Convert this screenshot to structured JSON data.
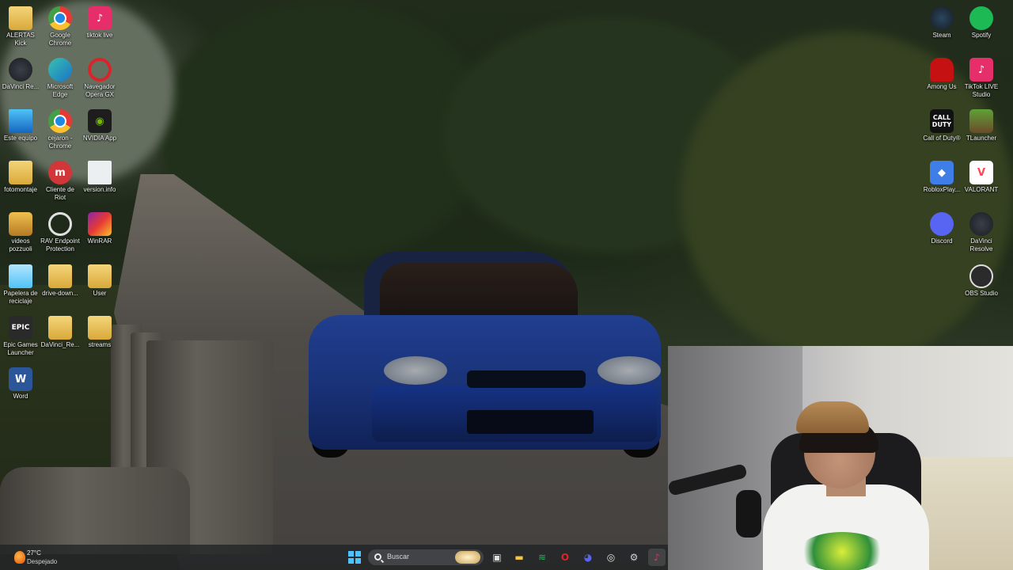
{
  "desktop": {
    "left_icons": [
      {
        "label": "ALERTAS Kick",
        "icon": "folder-icon"
      },
      {
        "label": "Google Chrome",
        "icon": "chrome-icon"
      },
      {
        "label": "tiktok live",
        "icon": "tiktok-icon"
      },
      {
        "label": "DaVinci Re...",
        "icon": "davinci-resolve-icon"
      },
      {
        "label": "Microsoft Edge",
        "icon": "edge-icon"
      },
      {
        "label": "Navegador Opera GX",
        "icon": "opera-gx-icon"
      },
      {
        "label": "Este equipo",
        "icon": "this-pc-icon"
      },
      {
        "label": "cejaron - Chrome",
        "icon": "chrome-icon"
      },
      {
        "label": "NVIDIA App",
        "icon": "nvidia-icon"
      },
      {
        "label": "fotomontaje",
        "icon": "folder-icon"
      },
      {
        "label": "Cliente de Riot",
        "icon": "riot-client-icon"
      },
      {
        "label": "version.info",
        "icon": "document-icon"
      },
      {
        "label": "videos pozzuoli",
        "icon": "folder-icon"
      },
      {
        "label": "RAV Endpoint Protection",
        "icon": "rav-endpoint-icon"
      },
      {
        "label": "WinRAR",
        "icon": "winrar-icon"
      },
      {
        "label": "Papelera de reciclaje",
        "icon": "recycle-bin-icon"
      },
      {
        "label": "drive-down...",
        "icon": "folder-icon"
      },
      {
        "label": "User",
        "icon": "folder-icon"
      },
      {
        "label": "Epic Games Launcher",
        "icon": "epic-games-icon"
      },
      {
        "label": "DaVinci_Re...",
        "icon": "folder-icon"
      },
      {
        "label": "streams",
        "icon": "folder-icon"
      },
      {
        "label": "Word",
        "icon": "word-icon"
      }
    ],
    "right_icons": [
      {
        "label": "Steam",
        "icon": "steam-icon"
      },
      {
        "label": "Spotify",
        "icon": "spotify-icon"
      },
      {
        "label": "Among Us",
        "icon": "among-us-icon"
      },
      {
        "label": "TikTok LIVE Studio",
        "icon": "tiktok-icon"
      },
      {
        "label": "Call of Duty®",
        "icon": "call-of-duty-icon"
      },
      {
        "label": "TLauncher",
        "icon": "tlauncher-icon"
      },
      {
        "label": "RobloxPlay...",
        "icon": "roblox-icon"
      },
      {
        "label": "VALORANT",
        "icon": "valorant-icon"
      },
      {
        "label": "Discord",
        "icon": "discord-icon"
      },
      {
        "label": "DaVinci Resolve",
        "icon": "davinci-resolve-icon"
      },
      {
        "label": "OBS Studio",
        "icon": "obs-icon"
      }
    ],
    "glyphs": {
      "epic": "EPIC",
      "word": "W",
      "cod": "CALL DUTY",
      "valorant": "V",
      "tiktok": "♪",
      "nvidia": "◉",
      "riot": "m",
      "roblox": "◆"
    }
  },
  "taskbar": {
    "weather": {
      "temperature": "27°C",
      "condition": "Despejado"
    },
    "search": {
      "placeholder": "Buscar"
    },
    "apps": [
      {
        "name": "task-view-button",
        "glyph": "▣"
      },
      {
        "name": "file-explorer-button",
        "glyph": "▬"
      },
      {
        "name": "spotify-taskbar-button",
        "glyph": "≋"
      },
      {
        "name": "opera-gx-taskbar-button",
        "glyph": "O"
      },
      {
        "name": "discord-taskbar-button",
        "glyph": "◕"
      },
      {
        "name": "chrome-taskbar-button",
        "glyph": "◎"
      },
      {
        "name": "steam-taskbar-button",
        "glyph": "⚙"
      },
      {
        "name": "tiktok-live-taskbar-button",
        "glyph": "♪"
      }
    ],
    "colors": {
      "windows_logo": "#4cc2ff",
      "spotify": "#1db954",
      "opera": "#d9252a",
      "discord": "#5865f2",
      "tiktok": "#e62f6a",
      "explorer": "#f4c542"
    }
  }
}
